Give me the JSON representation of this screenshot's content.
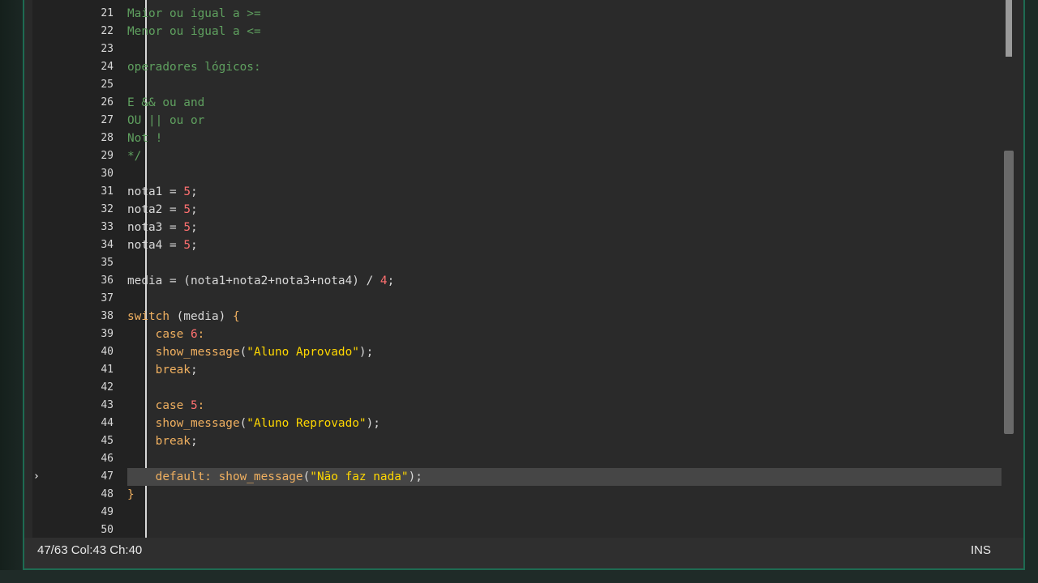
{
  "editor": {
    "lines": [
      {
        "n": "21",
        "segs": [
          [
            "c",
            "Maior ou igual a >="
          ]
        ]
      },
      {
        "n": "22",
        "segs": [
          [
            "c",
            "Menor ou igual a <="
          ]
        ]
      },
      {
        "n": "23",
        "segs": []
      },
      {
        "n": "24",
        "segs": [
          [
            "c",
            "operadores lógicos:"
          ]
        ]
      },
      {
        "n": "25",
        "segs": []
      },
      {
        "n": "26",
        "segs": [
          [
            "c",
            "E && ou and"
          ]
        ]
      },
      {
        "n": "27",
        "segs": [
          [
            "c",
            "OU || ou or"
          ]
        ]
      },
      {
        "n": "28",
        "segs": [
          [
            "c",
            "Not !"
          ]
        ]
      },
      {
        "n": "29",
        "segs": [
          [
            "c",
            "*/"
          ]
        ]
      },
      {
        "n": "30",
        "segs": []
      },
      {
        "n": "31",
        "segs": [
          [
            "v",
            "nota1 = "
          ],
          [
            "n",
            "5"
          ],
          [
            "p",
            ";"
          ]
        ]
      },
      {
        "n": "32",
        "segs": [
          [
            "v",
            "nota2 = "
          ],
          [
            "n",
            "5"
          ],
          [
            "p",
            ";"
          ]
        ]
      },
      {
        "n": "33",
        "segs": [
          [
            "v",
            "nota3 = "
          ],
          [
            "n",
            "5"
          ],
          [
            "p",
            ";"
          ]
        ]
      },
      {
        "n": "34",
        "segs": [
          [
            "v",
            "nota4 = "
          ],
          [
            "n",
            "5"
          ],
          [
            "p",
            ";"
          ]
        ]
      },
      {
        "n": "35",
        "segs": []
      },
      {
        "n": "36",
        "segs": [
          [
            "v",
            "media = (nota1+nota2+nota3+nota4) / "
          ],
          [
            "n",
            "4"
          ],
          [
            "p",
            ";"
          ]
        ]
      },
      {
        "n": "37",
        "segs": []
      },
      {
        "n": "38",
        "segs": [
          [
            "k",
            "switch"
          ],
          [
            "v",
            " (media) "
          ],
          [
            "k",
            "{"
          ]
        ]
      },
      {
        "n": "39",
        "segs": [
          [
            "v",
            "    "
          ],
          [
            "k",
            "case "
          ],
          [
            "n",
            "6"
          ],
          [
            "k",
            ":"
          ]
        ]
      },
      {
        "n": "40",
        "segs": [
          [
            "v",
            "    "
          ],
          [
            "k",
            "show_message"
          ],
          [
            "p",
            "("
          ],
          [
            "s",
            "\"Aluno Aprovado\""
          ],
          [
            "p",
            ");"
          ]
        ]
      },
      {
        "n": "41",
        "segs": [
          [
            "v",
            "    "
          ],
          [
            "k",
            "break"
          ],
          [
            "p",
            ";"
          ]
        ]
      },
      {
        "n": "42",
        "segs": []
      },
      {
        "n": "43",
        "segs": [
          [
            "v",
            "    "
          ],
          [
            "k",
            "case "
          ],
          [
            "n",
            "5"
          ],
          [
            "k",
            ":"
          ]
        ]
      },
      {
        "n": "44",
        "segs": [
          [
            "v",
            "    "
          ],
          [
            "k",
            "show_message"
          ],
          [
            "p",
            "("
          ],
          [
            "s",
            "\"Aluno Reprovado\""
          ],
          [
            "p",
            ");"
          ]
        ]
      },
      {
        "n": "45",
        "segs": [
          [
            "v",
            "    "
          ],
          [
            "k",
            "break"
          ],
          [
            "p",
            ";"
          ]
        ]
      },
      {
        "n": "46",
        "segs": []
      },
      {
        "n": "47",
        "segs": [
          [
            "v",
            "    "
          ],
          [
            "k",
            "default: show_message"
          ],
          [
            "p",
            "("
          ],
          [
            "s",
            "\"Não faz nada\""
          ],
          [
            "p",
            ");"
          ]
        ]
      },
      {
        "n": "48",
        "segs": [
          [
            "k",
            "}"
          ]
        ]
      },
      {
        "n": "49",
        "segs": []
      },
      {
        "n": "50",
        "segs": []
      }
    ],
    "current_line": "47",
    "current_line_marker": "›"
  },
  "statusbar": {
    "position": "47/63 Col:43 Ch:40",
    "mode": "INS"
  },
  "colors": {
    "comment": "#5fa05f",
    "keyword": "#f0b060",
    "number": "#ff7070",
    "string": "#ffd700",
    "window_border": "#1e6b52"
  }
}
